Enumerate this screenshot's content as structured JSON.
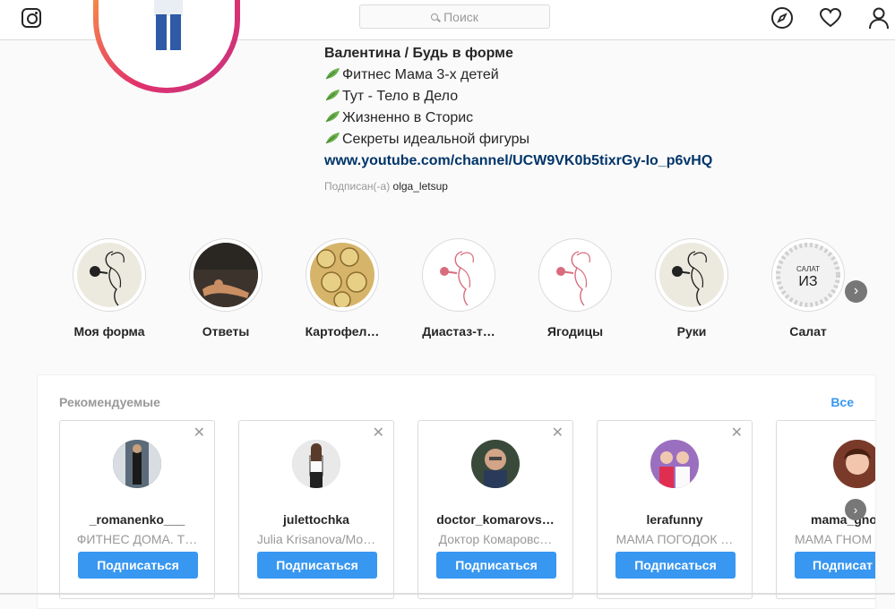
{
  "header": {
    "search_placeholder": "Поиск",
    "icons": [
      "instagram-logo-icon",
      "compass-icon",
      "heart-icon",
      "person-icon"
    ]
  },
  "profile": {
    "bio_name": "Валентина / Будь в форме",
    "bio_lines": [
      "Фитнес Мама 3-х детей",
      "Тут - Тело в Дело",
      "Жизненно в Сторис",
      "Секреты идеальной фигуры"
    ],
    "bio_link": "www.youtube.com/channel/UCW9VK0b5tixrGy-Io_p6vHQ",
    "followed_label": "Подписан(-а)",
    "followed_user": "olga_letsup"
  },
  "highlights": [
    {
      "label": "Моя форма"
    },
    {
      "label": "Ответы"
    },
    {
      "label": "Картофел…"
    },
    {
      "label": "Диастаз-т…"
    },
    {
      "label": "Ягодицы"
    },
    {
      "label": "Руки"
    },
    {
      "label": "Салат",
      "cover_text_top": "САЛАТ",
      "cover_text_main": "ИЗ"
    }
  ],
  "suggested": {
    "title": "Рекомендуемые",
    "see_all": "Все",
    "cards": [
      {
        "username": "_romanenko___",
        "name": "ФИТНЕС ДОМА. Т…",
        "button": "Подписаться"
      },
      {
        "username": "julettochka",
        "name": "Julia Krisanova/Mo…",
        "button": "Подписаться"
      },
      {
        "username": "doctor_komarovs…",
        "name": "Доктор Комаровс…",
        "button": "Подписаться"
      },
      {
        "username": "lerafunny",
        "name": "МАМА ПОГОДОК …",
        "button": "Подписаться"
      },
      {
        "username": "mama_gno",
        "name": "МАМА ГНОМ",
        "button": "Подписат"
      }
    ]
  },
  "colors": {
    "accent": "#3897f0",
    "link": "#003569",
    "ring_gradient": [
      "#f9a03f",
      "#e1306c",
      "#c13584"
    ]
  }
}
